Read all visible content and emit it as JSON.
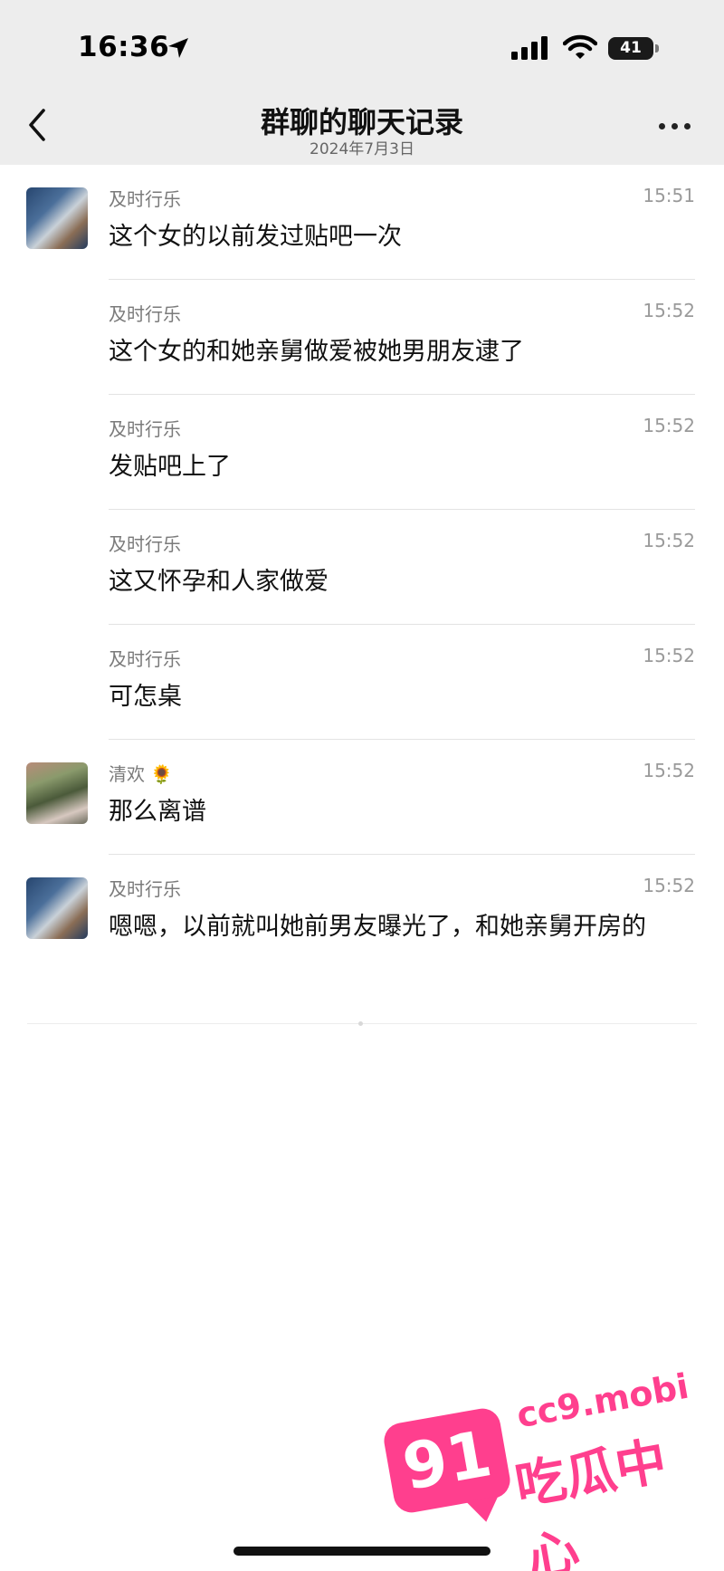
{
  "status_bar": {
    "time": "16:36",
    "battery": "41",
    "icons": [
      "location-arrow-icon",
      "signal-bars-icon",
      "wifi-icon",
      "battery-icon"
    ]
  },
  "header": {
    "title": "群聊的聊天记录",
    "date": "2024年7月3日"
  },
  "messages": [
    {
      "sender": "及时行乐",
      "time": "15:51",
      "text": "这个女的以前发过贴吧一次",
      "avatar": "avatar-a"
    },
    {
      "sender": "及时行乐",
      "time": "15:52",
      "text": "这个女的和她亲舅做爱被她男朋友逮了"
    },
    {
      "sender": "及时行乐",
      "time": "15:52",
      "text": "发贴吧上了"
    },
    {
      "sender": "及时行乐",
      "time": "15:52",
      "text": "这又怀孕和人家做爱"
    },
    {
      "sender": "及时行乐",
      "time": "15:52",
      "text": "可怎桌"
    },
    {
      "sender": "清欢 🌻",
      "time": "15:52",
      "text": "那么离谱",
      "avatar": "avatar-b"
    },
    {
      "sender": "及时行乐",
      "time": "15:52",
      "text": "嗯嗯，以前就叫她前男友曝光了，和她亲舅开房的",
      "avatar": "avatar-a"
    }
  ],
  "watermark": {
    "number": "91",
    "domain": "cc9.mobi",
    "brand": "吃瓜中心"
  },
  "colors": {
    "header_bg": "#ededed",
    "page_bg": "#ffffff",
    "watermark": "#ff3f8e"
  }
}
